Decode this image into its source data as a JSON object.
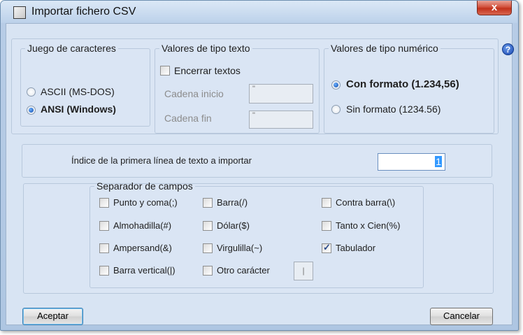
{
  "window": {
    "title": "Importar fichero CSV",
    "close_symbol": "x",
    "help_symbol": "?"
  },
  "charset": {
    "label": "Juego de caracteres",
    "options": [
      "ASCII (MS-DOS)",
      "ANSI (Windows)"
    ],
    "selected": "ANSI (Windows)"
  },
  "text_values": {
    "label": "Valores de tipo texto",
    "enclose_label": "Encerrar textos",
    "enclose_checked": false,
    "start_label": "Cadena inicio",
    "start_value": "\"",
    "end_label": "Cadena fin",
    "end_value": "\""
  },
  "numeric_values": {
    "label": "Valores de tipo numérico",
    "options": [
      "Con formato (1.234,56)",
      "Sin formato (1234.56)"
    ],
    "selected": "Con formato (1.234,56)"
  },
  "first_line": {
    "label": "Índice de la primera línea de texto a importar",
    "value": "1"
  },
  "separators": {
    "label": "Separador de campos",
    "items": [
      {
        "label": "Punto y coma(;)",
        "checked": false
      },
      {
        "label": "Barra(/)",
        "checked": false
      },
      {
        "label": "Contra barra(\\)",
        "checked": false
      },
      {
        "label": "Almohadilla(#)",
        "checked": false
      },
      {
        "label": "Dólar($)",
        "checked": false
      },
      {
        "label": "Tanto x Cien(%)",
        "checked": false
      },
      {
        "label": "Ampersand(&)",
        "checked": false
      },
      {
        "label": "Virgulilla(~)",
        "checked": false
      },
      {
        "label": "Tabulador",
        "checked": true
      },
      {
        "label": "Barra vertical(|)",
        "checked": false
      },
      {
        "label": "Otro carácter",
        "checked": false
      }
    ],
    "other_value": "|"
  },
  "buttons": {
    "accept": "Aceptar",
    "cancel": "Cancelar"
  },
  "colors": {
    "client_bg": "#d8e4f3",
    "close_button": "#c2321c",
    "radio_selected": "#114aa8"
  }
}
